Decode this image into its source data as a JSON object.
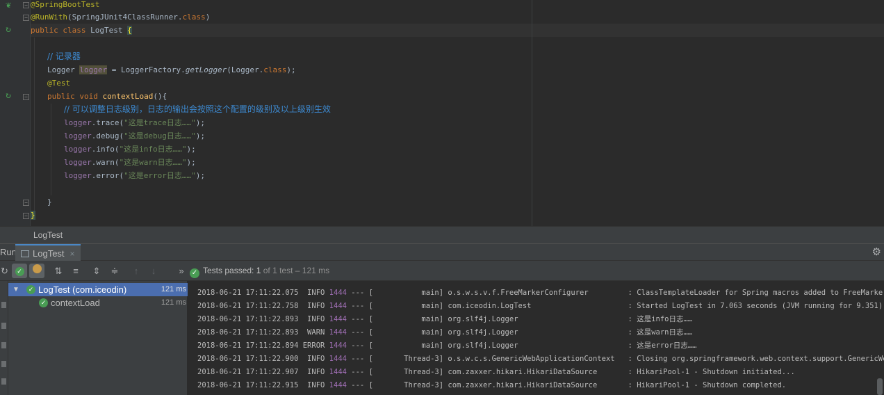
{
  "editor": {
    "lines": {
      "l1": "@SpringBootTest",
      "l2a": "@RunWith",
      "l2b": "(SpringJUnit4ClassRunner.",
      "l2c": "class",
      "l2d": ")",
      "l3a": "public class ",
      "l3b": "LogTest ",
      "l3c": "{",
      "l5": "// 记录器",
      "l6a": "Logger ",
      "l6b": "logger",
      "l6c": " = LoggerFactory.",
      "l6d": "getLogger",
      "l6e": "(Logger.",
      "l6f": "class",
      "l6g": ");",
      "l7": "@Test",
      "l8a": "public void ",
      "l8b": "contextLoad",
      "l8c": "(){",
      "l9": "// 可以调整日志级别，日志的输出会按照这个配置的级别及以上级别生效",
      "l10a": "logger",
      "l10b": ".trace(",
      "l10c": "\"这是trace日志……\"",
      "l10d": ");",
      "l11a": "logger",
      "l11b": ".debug(",
      "l11c": "\"这是debug日志……\"",
      "l11d": ");",
      "l12a": "logger",
      "l12b": ".info(",
      "l12c": "\"这是info日志……\"",
      "l12d": ");",
      "l13a": "logger",
      "l13b": ".warn(",
      "l13c": "\"这是warn日志……\"",
      "l13d": ");",
      "l14a": "logger",
      "l14b": ".error(",
      "l14c": "\"这是error日志……\"",
      "l14d": ");",
      "l16": "}",
      "l17": "}"
    }
  },
  "breadcrumb": {
    "label": "LogTest"
  },
  "run_window": {
    "label": "Run:",
    "tab_label": "LogTest",
    "tab_close": "×",
    "gear": "⚙"
  },
  "toolbar": {
    "expand_label": "»",
    "status_prefix": "Tests passed: ",
    "passed": "1",
    "status_of": " of 1 test",
    "status_time": " – 121 ms"
  },
  "tree": {
    "root": {
      "label": "LogTest (com.iceodin)",
      "time": "121 ms"
    },
    "child": {
      "label": "contextLoad",
      "time": "121 ms"
    }
  },
  "console": {
    "rows": [
      {
        "ts": "2018-06-21 17:11:22.075",
        "level": " INFO",
        "pid": "1444",
        "thread": " --- [           main]",
        "logger": " o.s.w.s.v.f.FreeMarkerConfigurer        ",
        "msg": " : ClassTemplateLoader for Spring macros added to FreeMarker configuration"
      },
      {
        "ts": "2018-06-21 17:11:22.758",
        "level": " INFO",
        "pid": "1444",
        "thread": " --- [           main]",
        "logger": " com.iceodin.LogTest                     ",
        "msg": " : Started LogTest in 7.063 seconds (JVM running for 9.351)"
      },
      {
        "ts": "2018-06-21 17:11:22.893",
        "level": " INFO",
        "pid": "1444",
        "thread": " --- [           main]",
        "logger": " org.slf4j.Logger                        ",
        "msg": " : 这是info日志……"
      },
      {
        "ts": "2018-06-21 17:11:22.893",
        "level": " WARN",
        "pid": "1444",
        "thread": " --- [           main]",
        "logger": " org.slf4j.Logger                        ",
        "msg": " : 这是warn日志……"
      },
      {
        "ts": "2018-06-21 17:11:22.894",
        "level": "ERROR",
        "pid": "1444",
        "thread": " --- [           main]",
        "logger": " org.slf4j.Logger                        ",
        "msg": " : 这是error日志……"
      },
      {
        "ts": "2018-06-21 17:11:22.900",
        "level": " INFO",
        "pid": "1444",
        "thread": " --- [       Thread-3]",
        "logger": " o.s.w.c.s.GenericWebApplicationContext  ",
        "msg": " : Closing org.springframework.web.context.support.GenericWebApplicationContext"
      },
      {
        "ts": "2018-06-21 17:11:22.907",
        "level": " INFO",
        "pid": "1444",
        "thread": " --- [       Thread-3]",
        "logger": " com.zaxxer.hikari.HikariDataSource      ",
        "msg": " : HikariPool-1 - Shutdown initiated..."
      },
      {
        "ts": "2018-06-21 17:11:22.915",
        "level": " INFO",
        "pid": "1444",
        "thread": " --- [       Thread-3]",
        "logger": " com.zaxxer.hikari.HikariDataSource      ",
        "msg": " : HikariPool-1 - Shutdown completed."
      }
    ]
  },
  "colors": {
    "accent": "#4a88c7",
    "pass_green": "#499c54",
    "selection": "#4b6eaf"
  }
}
